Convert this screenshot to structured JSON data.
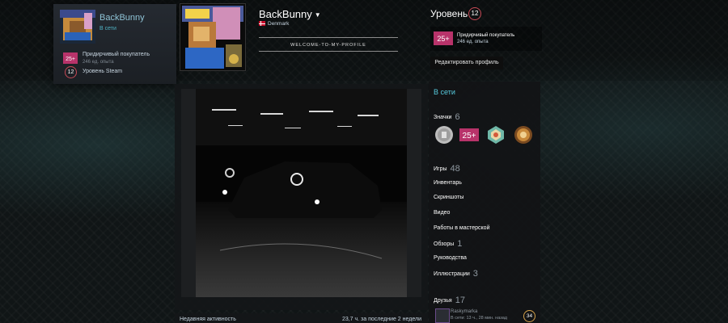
{
  "mini_profile": {
    "name": "BackBunny",
    "status": "В сети",
    "badge_name": "Придирчивый покупатель",
    "badge_xp": "246 ед. опыта",
    "badge_icon_text": "25+",
    "level": "12",
    "level_label": "Уровень Steam"
  },
  "profile": {
    "name": "BackBunny",
    "location": "Denmark",
    "summary": "WELCOME-TO-MY-PROFILE"
  },
  "header_right": {
    "level_title": "Уровень",
    "level": "12",
    "fav_badge_icon_text": "25+",
    "fav_badge_name": "Придирчивый покупатель",
    "fav_badge_xp": "246 ед. опыта",
    "edit_label": "Редактировать профиль"
  },
  "activity": {
    "left": "Недавняя активность",
    "right": "23,7 ч. за последние 2 недели"
  },
  "sidebar": {
    "online_status": "В сети",
    "badges_label": "Значки",
    "badges_count": "6",
    "badge_25_text": "25+",
    "games_label": "Игры",
    "games_count": "48",
    "inventory": "Инвентарь",
    "screenshots": "Скриншоты",
    "videos": "Видео",
    "workshop": "Работы в мастерской",
    "reviews_label": "Обзоры",
    "reviews_count": "1",
    "guides": "Руководства",
    "artwork_label": "Иллюстрации",
    "artwork_count": "3",
    "friends_label": "Друзья",
    "friends_count": "17",
    "friend_name": "Raskymarka",
    "friend_status": "В сети: 13 ч., 28 мин. назад",
    "friend_level": "34"
  },
  "colors": {
    "online": "#57cbde",
    "level_ring": "#c84a56",
    "friend_level_ring": "#d6a24b",
    "badge_magenta": "#b8336a"
  },
  "icons": [
    "avatar-image",
    "flag-denmark-icon",
    "caret-down-icon",
    "badge-25-icon",
    "coin-badge-icon",
    "gem-badge-icon",
    "laurel-badge-icon"
  ]
}
